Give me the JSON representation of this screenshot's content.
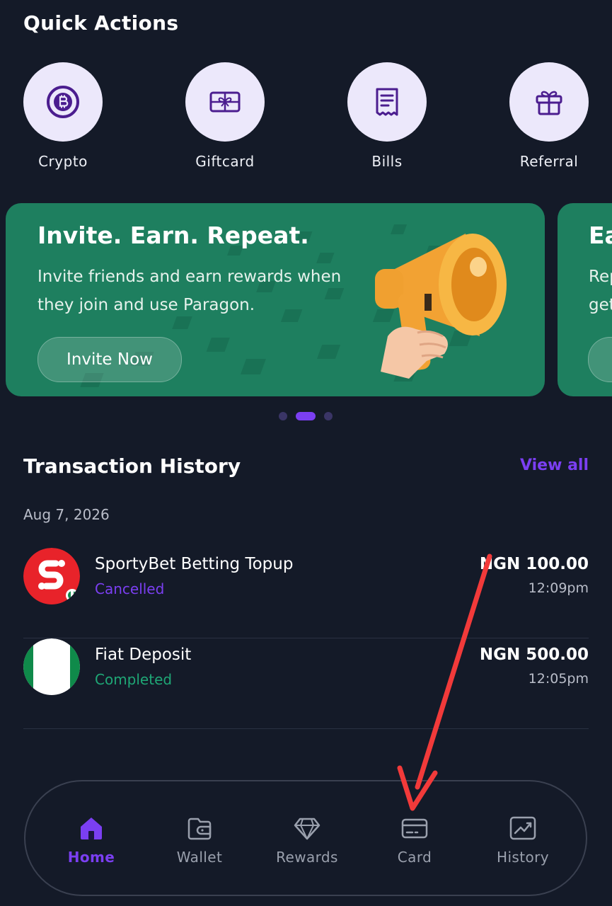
{
  "quick_actions": {
    "title": "Quick Actions",
    "items": [
      {
        "label": "Crypto",
        "icon": "bitcoin-icon"
      },
      {
        "label": "Giftcard",
        "icon": "giftcard-icon"
      },
      {
        "label": "Bills",
        "icon": "receipt-icon"
      },
      {
        "label": "Referral",
        "icon": "gift-icon"
      }
    ]
  },
  "banners": [
    {
      "title": "Invite. Earn. Repeat.",
      "text_line1": "Invite friends and earn rewards when",
      "text_line2": "they join and use Paragon.",
      "button": "Invite Now"
    },
    {
      "title": "Ea",
      "text_line1": "Rep",
      "text_line2": "get"
    }
  ],
  "carousel": {
    "count": 3,
    "active_index": 1
  },
  "transactions": {
    "title": "Transaction History",
    "view_all": "View all",
    "date": "Aug 7, 2026",
    "items": [
      {
        "name": "SportyBet Betting Topup",
        "status": "Cancelled",
        "status_color": "#7b3ff2",
        "amount": "NGN 100.00",
        "time": "12:09pm"
      },
      {
        "name": "Fiat Deposit",
        "status": "Completed",
        "status_color": "#1fa776",
        "amount": "NGN 500.00",
        "time": "12:05pm"
      }
    ]
  },
  "nav": {
    "items": [
      {
        "label": "Home",
        "icon": "home-icon",
        "active": true
      },
      {
        "label": "Wallet",
        "icon": "wallet-icon",
        "active": false
      },
      {
        "label": "Rewards",
        "icon": "diamond-icon",
        "active": false
      },
      {
        "label": "Card",
        "icon": "card-icon",
        "active": false
      },
      {
        "label": "History",
        "icon": "chart-icon",
        "active": false
      }
    ]
  },
  "colors": {
    "background": "#141a28",
    "accent": "#7b3ff2",
    "banner": "#1e7f5f",
    "icon_circle": "#ece8fb",
    "annotation_arrow": "#f23a3a"
  }
}
